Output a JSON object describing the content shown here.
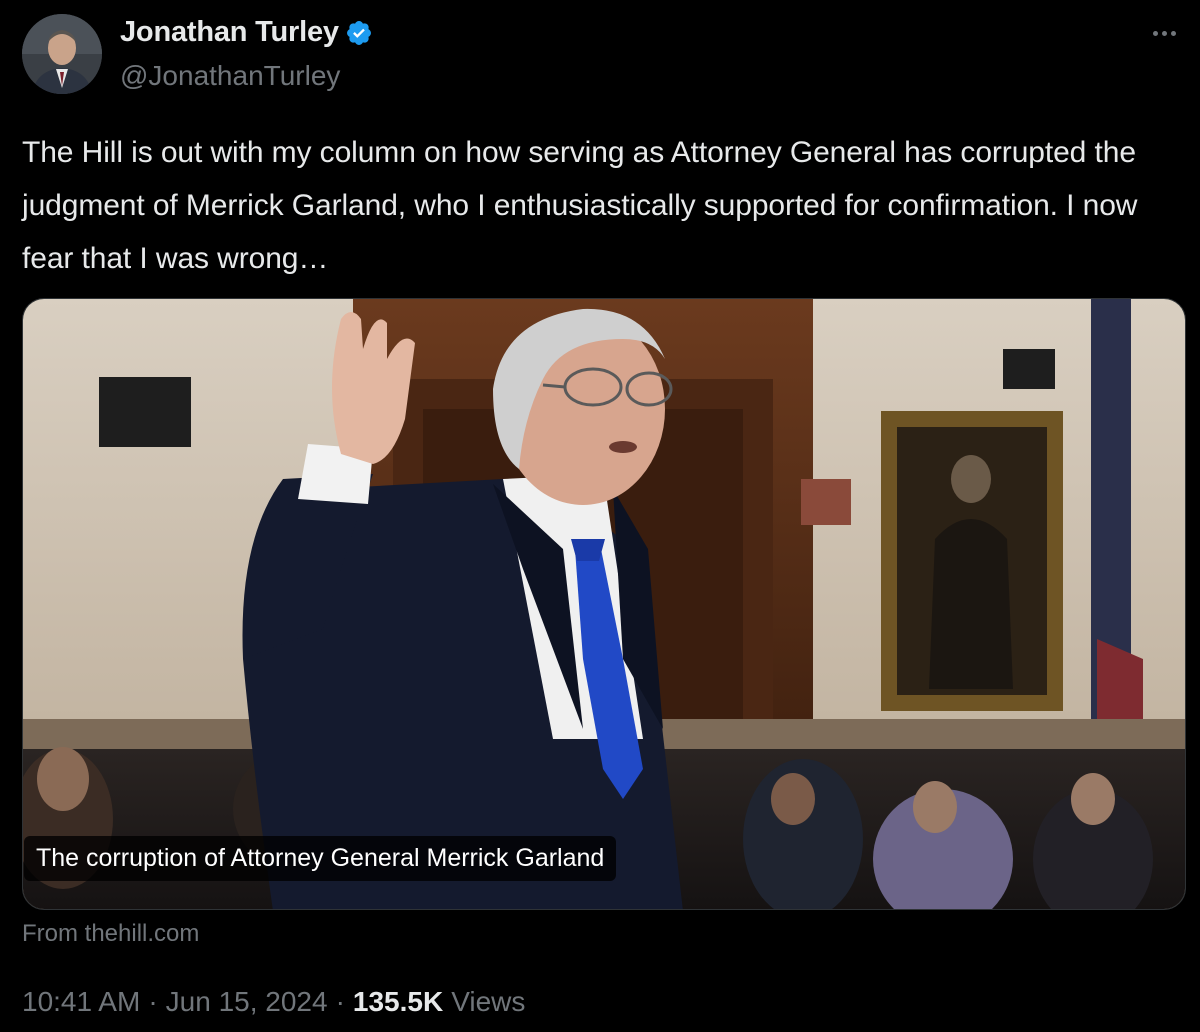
{
  "author": {
    "name": "Jonathan Turley",
    "handle": "@JonathanTurley",
    "verified": true
  },
  "tweet": {
    "text": "The Hill is out with my column on how serving as Attorney General has corrupted the judgment of Merrick Garland, who I enthusiastically supported for confirmation. I now fear that I was wrong…"
  },
  "card": {
    "caption": "The corruption of Attorney General Merrick Garland",
    "source": "From thehill.com"
  },
  "meta": {
    "time": "10:41 AM",
    "separator": "·",
    "date": "Jun 15, 2024",
    "views_count": "135.5K",
    "views_label": "Views"
  },
  "icons": {
    "verified": "verified-badge-icon",
    "more": "more-options-icon"
  },
  "colors": {
    "background": "#000000",
    "text": "#e7e9ea",
    "secondary": "#71767b",
    "verified": "#1d9bf0"
  }
}
